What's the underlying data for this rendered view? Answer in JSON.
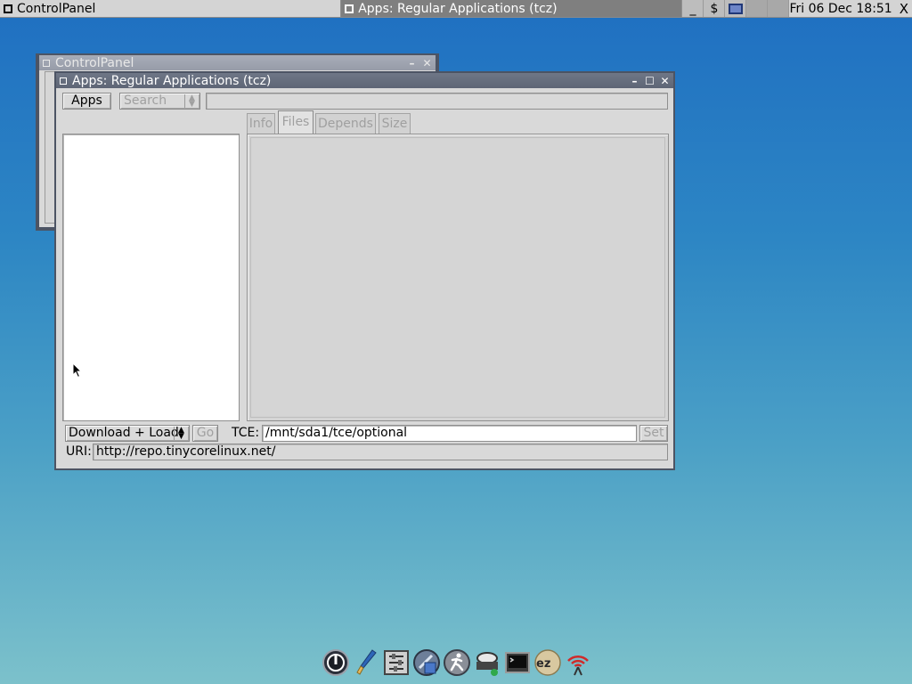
{
  "taskbar": {
    "tasks": [
      {
        "label": "ControlPanel"
      },
      {
        "label": "Apps: Regular Applications (tcz)"
      }
    ],
    "tray": {
      "minimize": "_",
      "terminal": "$"
    },
    "clock": "Fri 06 Dec 18:51",
    "close": "X"
  },
  "bg_window": {
    "title": "ControlPanel",
    "buttons": {
      "minimize": "–",
      "close": "✕"
    }
  },
  "apps_window": {
    "title": "Apps: Regular Applications (tcz)",
    "buttons": {
      "minimize": "–",
      "maximize": "☐",
      "close": "✕"
    },
    "apps_button": "Apps",
    "search_select": "Search",
    "search_value": "",
    "tabs": [
      {
        "label": "Info",
        "selected": false
      },
      {
        "label": "Files",
        "selected": true
      },
      {
        "label": "Depends",
        "selected": false
      },
      {
        "label": "Size",
        "selected": false
      }
    ],
    "mode_select": "Download + Load",
    "go_button": "Go",
    "tce_label": "TCE:",
    "tce_value": "/mnt/sda1/tce/optional",
    "set_button": "Set",
    "uri_label": "URI:",
    "uri_value": "http://repo.tinycorelinux.net/"
  },
  "dock": {
    "items": [
      {
        "icon": "power-icon"
      },
      {
        "icon": "brush-icon"
      },
      {
        "icon": "control-panel-icon"
      },
      {
        "icon": "apps-icon"
      },
      {
        "icon": "run-icon"
      },
      {
        "icon": "mount-tool-icon"
      },
      {
        "icon": "terminal-icon"
      },
      {
        "icon": "ezremaster-icon"
      },
      {
        "icon": "wireless-icon"
      }
    ]
  },
  "colors": {
    "desktop_top": "#1f6fc1",
    "desktop_bottom": "#7cc1cb",
    "titlebar": "#646b7c",
    "window_bg": "#d9d9d9"
  }
}
